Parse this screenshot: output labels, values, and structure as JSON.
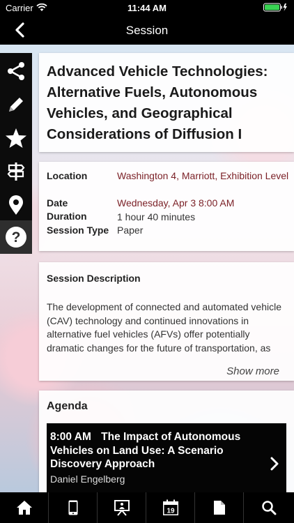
{
  "status_bar": {
    "carrier": "Carrier",
    "time": "11:44 AM"
  },
  "nav": {
    "title": "Session"
  },
  "session": {
    "title": "Advanced Vehicle Technologies: Alternative Fuels, Autonomous Vehicles, and Geographical Considerations of Diffusion I",
    "details": {
      "location_label": "Location",
      "location_value": "Washington 4, Marriott, Exhibition Level",
      "date_label": "Date",
      "date_value": "Wednesday, Apr 3 8:00 AM",
      "duration_label": "Duration",
      "duration_value": "1 hour 40 minutes",
      "type_label": "Session Type",
      "type_value": "Paper"
    },
    "description": {
      "heading": "Session Description",
      "text": "The development of connected and automated vehicle (CAV) technology and continued innovations in alternative fuel vehicles (AFVs) offer potentially dramatic changes for the future of transportation, as",
      "show_more": "Show more"
    },
    "agenda": {
      "heading": "Agenda",
      "items": [
        {
          "time": "8:00 AM",
          "title": "The Impact of Autonomous Vehicles on Land Use: A Scenario Discovery Approach",
          "speaker": "Daniel Engelberg"
        }
      ]
    }
  },
  "sidebar": {
    "items": [
      "share-icon",
      "pencil-icon",
      "star-icon",
      "signpost-icon",
      "map-pin-icon",
      "help-icon"
    ]
  },
  "tabbar": {
    "items": [
      "home-icon",
      "mobile-device-icon",
      "presentation-icon",
      "calendar-icon",
      "document-icon",
      "search-icon"
    ],
    "calendar_day": "19"
  },
  "colors": {
    "accent_link": "#7a1f25",
    "bar": "#000000"
  }
}
